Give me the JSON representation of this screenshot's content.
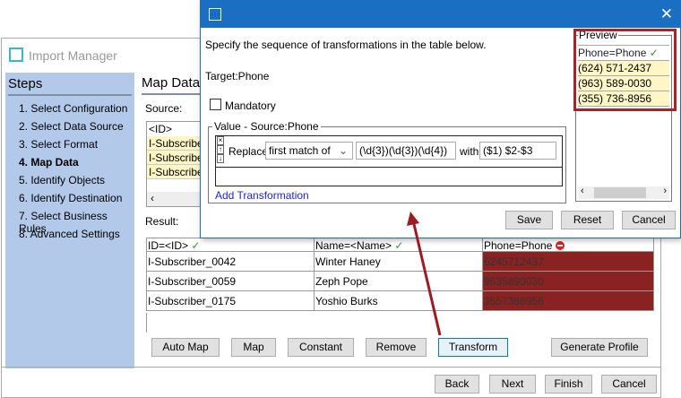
{
  "window": {
    "title": "Import Manager"
  },
  "steps": {
    "heading": "Steps",
    "items": [
      "1. Select Configuration",
      "2. Select Data Source",
      "3. Select Format",
      "4. Map Data",
      "5. Identify Objects",
      "6. Identify Destination",
      "7. Select Business Rules",
      "8. Advanced Settings"
    ],
    "current": 3
  },
  "main": {
    "title": "Map Data",
    "source_label": "Source:",
    "source_header": "<ID>",
    "source_rows": [
      "I-Subscriber_",
      "I-Subscriber_",
      "I-Subscriber_"
    ],
    "result_label": "Result:",
    "columns": [
      {
        "label": "ID=<ID>",
        "status": "✓"
      },
      {
        "label": "Name=<Name>",
        "status": "✓"
      },
      {
        "label": "Phone=Phone",
        "status": "error"
      }
    ],
    "rows": [
      [
        "I-Subscriber_0042",
        "Winter Haney",
        "6245712437"
      ],
      [
        "I-Subscriber_0059",
        "Zeph Pope",
        "9635890030"
      ],
      [
        "I-Subscriber_0175",
        "Yoshio Burks",
        "3557368956"
      ]
    ],
    "buttons": [
      "Auto Map",
      "Map",
      "Constant",
      "Remove",
      "Transform",
      "Generate Profile"
    ]
  },
  "nav": {
    "back": "Back",
    "next": "Next",
    "finish": "Finish",
    "cancel": "Cancel"
  },
  "dialog": {
    "instructions": "Specify the sequence of transformations in the table below.",
    "target": "Target:Phone",
    "mandatory_label": "Mandatory",
    "mandatory": false,
    "group_label": "Value - Source:Phone",
    "transform": {
      "action": "Replace",
      "mode": "first match of",
      "pattern": "(\\d{3})(\\d{3})(\\d{4})",
      "with_label": "with",
      "replacement": "($1) $2-$3"
    },
    "add_link": "Add Transformation",
    "preview": {
      "label": "Preview",
      "header": "Phone=Phone",
      "header_status": "✓",
      "rows": [
        "(624) 571-2437",
        "(963) 589-0030",
        "(355) 736-8956"
      ]
    },
    "save": "Save",
    "reset": "Reset",
    "cancel": "Cancel",
    "close": "✕"
  },
  "colors": {
    "accent": "#1b6fc3",
    "error_cell": "#8b2222",
    "highlight": "#a4262c",
    "preview_row": "#fff6c6"
  }
}
